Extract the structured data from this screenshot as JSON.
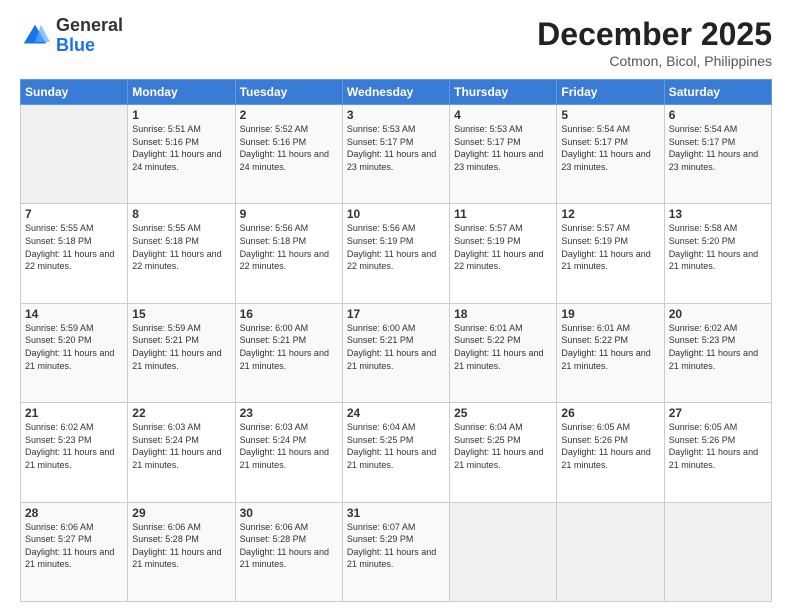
{
  "logo": {
    "text_general": "General",
    "text_blue": "Blue"
  },
  "header": {
    "month_year": "December 2025",
    "location": "Cotmon, Bicol, Philippines"
  },
  "weekdays": [
    "Sunday",
    "Monday",
    "Tuesday",
    "Wednesday",
    "Thursday",
    "Friday",
    "Saturday"
  ],
  "weeks": [
    [
      {
        "day": "",
        "sunrise": "",
        "sunset": "",
        "daylight": ""
      },
      {
        "day": "1",
        "sunrise": "Sunrise: 5:51 AM",
        "sunset": "Sunset: 5:16 PM",
        "daylight": "Daylight: 11 hours and 24 minutes."
      },
      {
        "day": "2",
        "sunrise": "Sunrise: 5:52 AM",
        "sunset": "Sunset: 5:16 PM",
        "daylight": "Daylight: 11 hours and 24 minutes."
      },
      {
        "day": "3",
        "sunrise": "Sunrise: 5:53 AM",
        "sunset": "Sunset: 5:17 PM",
        "daylight": "Daylight: 11 hours and 23 minutes."
      },
      {
        "day": "4",
        "sunrise": "Sunrise: 5:53 AM",
        "sunset": "Sunset: 5:17 PM",
        "daylight": "Daylight: 11 hours and 23 minutes."
      },
      {
        "day": "5",
        "sunrise": "Sunrise: 5:54 AM",
        "sunset": "Sunset: 5:17 PM",
        "daylight": "Daylight: 11 hours and 23 minutes."
      },
      {
        "day": "6",
        "sunrise": "Sunrise: 5:54 AM",
        "sunset": "Sunset: 5:17 PM",
        "daylight": "Daylight: 11 hours and 23 minutes."
      }
    ],
    [
      {
        "day": "7",
        "sunrise": "Sunrise: 5:55 AM",
        "sunset": "Sunset: 5:18 PM",
        "daylight": "Daylight: 11 hours and 22 minutes."
      },
      {
        "day": "8",
        "sunrise": "Sunrise: 5:55 AM",
        "sunset": "Sunset: 5:18 PM",
        "daylight": "Daylight: 11 hours and 22 minutes."
      },
      {
        "day": "9",
        "sunrise": "Sunrise: 5:56 AM",
        "sunset": "Sunset: 5:18 PM",
        "daylight": "Daylight: 11 hours and 22 minutes."
      },
      {
        "day": "10",
        "sunrise": "Sunrise: 5:56 AM",
        "sunset": "Sunset: 5:19 PM",
        "daylight": "Daylight: 11 hours and 22 minutes."
      },
      {
        "day": "11",
        "sunrise": "Sunrise: 5:57 AM",
        "sunset": "Sunset: 5:19 PM",
        "daylight": "Daylight: 11 hours and 22 minutes."
      },
      {
        "day": "12",
        "sunrise": "Sunrise: 5:57 AM",
        "sunset": "Sunset: 5:19 PM",
        "daylight": "Daylight: 11 hours and 21 minutes."
      },
      {
        "day": "13",
        "sunrise": "Sunrise: 5:58 AM",
        "sunset": "Sunset: 5:20 PM",
        "daylight": "Daylight: 11 hours and 21 minutes."
      }
    ],
    [
      {
        "day": "14",
        "sunrise": "Sunrise: 5:59 AM",
        "sunset": "Sunset: 5:20 PM",
        "daylight": "Daylight: 11 hours and 21 minutes."
      },
      {
        "day": "15",
        "sunrise": "Sunrise: 5:59 AM",
        "sunset": "Sunset: 5:21 PM",
        "daylight": "Daylight: 11 hours and 21 minutes."
      },
      {
        "day": "16",
        "sunrise": "Sunrise: 6:00 AM",
        "sunset": "Sunset: 5:21 PM",
        "daylight": "Daylight: 11 hours and 21 minutes."
      },
      {
        "day": "17",
        "sunrise": "Sunrise: 6:00 AM",
        "sunset": "Sunset: 5:21 PM",
        "daylight": "Daylight: 11 hours and 21 minutes."
      },
      {
        "day": "18",
        "sunrise": "Sunrise: 6:01 AM",
        "sunset": "Sunset: 5:22 PM",
        "daylight": "Daylight: 11 hours and 21 minutes."
      },
      {
        "day": "19",
        "sunrise": "Sunrise: 6:01 AM",
        "sunset": "Sunset: 5:22 PM",
        "daylight": "Daylight: 11 hours and 21 minutes."
      },
      {
        "day": "20",
        "sunrise": "Sunrise: 6:02 AM",
        "sunset": "Sunset: 5:23 PM",
        "daylight": "Daylight: 11 hours and 21 minutes."
      }
    ],
    [
      {
        "day": "21",
        "sunrise": "Sunrise: 6:02 AM",
        "sunset": "Sunset: 5:23 PM",
        "daylight": "Daylight: 11 hours and 21 minutes."
      },
      {
        "day": "22",
        "sunrise": "Sunrise: 6:03 AM",
        "sunset": "Sunset: 5:24 PM",
        "daylight": "Daylight: 11 hours and 21 minutes."
      },
      {
        "day": "23",
        "sunrise": "Sunrise: 6:03 AM",
        "sunset": "Sunset: 5:24 PM",
        "daylight": "Daylight: 11 hours and 21 minutes."
      },
      {
        "day": "24",
        "sunrise": "Sunrise: 6:04 AM",
        "sunset": "Sunset: 5:25 PM",
        "daylight": "Daylight: 11 hours and 21 minutes."
      },
      {
        "day": "25",
        "sunrise": "Sunrise: 6:04 AM",
        "sunset": "Sunset: 5:25 PM",
        "daylight": "Daylight: 11 hours and 21 minutes."
      },
      {
        "day": "26",
        "sunrise": "Sunrise: 6:05 AM",
        "sunset": "Sunset: 5:26 PM",
        "daylight": "Daylight: 11 hours and 21 minutes."
      },
      {
        "day": "27",
        "sunrise": "Sunrise: 6:05 AM",
        "sunset": "Sunset: 5:26 PM",
        "daylight": "Daylight: 11 hours and 21 minutes."
      }
    ],
    [
      {
        "day": "28",
        "sunrise": "Sunrise: 6:06 AM",
        "sunset": "Sunset: 5:27 PM",
        "daylight": "Daylight: 11 hours and 21 minutes."
      },
      {
        "day": "29",
        "sunrise": "Sunrise: 6:06 AM",
        "sunset": "Sunset: 5:28 PM",
        "daylight": "Daylight: 11 hours and 21 minutes."
      },
      {
        "day": "30",
        "sunrise": "Sunrise: 6:06 AM",
        "sunset": "Sunset: 5:28 PM",
        "daylight": "Daylight: 11 hours and 21 minutes."
      },
      {
        "day": "31",
        "sunrise": "Sunrise: 6:07 AM",
        "sunset": "Sunset: 5:29 PM",
        "daylight": "Daylight: 11 hours and 21 minutes."
      },
      {
        "day": "",
        "sunrise": "",
        "sunset": "",
        "daylight": ""
      },
      {
        "day": "",
        "sunrise": "",
        "sunset": "",
        "daylight": ""
      },
      {
        "day": "",
        "sunrise": "",
        "sunset": "",
        "daylight": ""
      }
    ]
  ]
}
